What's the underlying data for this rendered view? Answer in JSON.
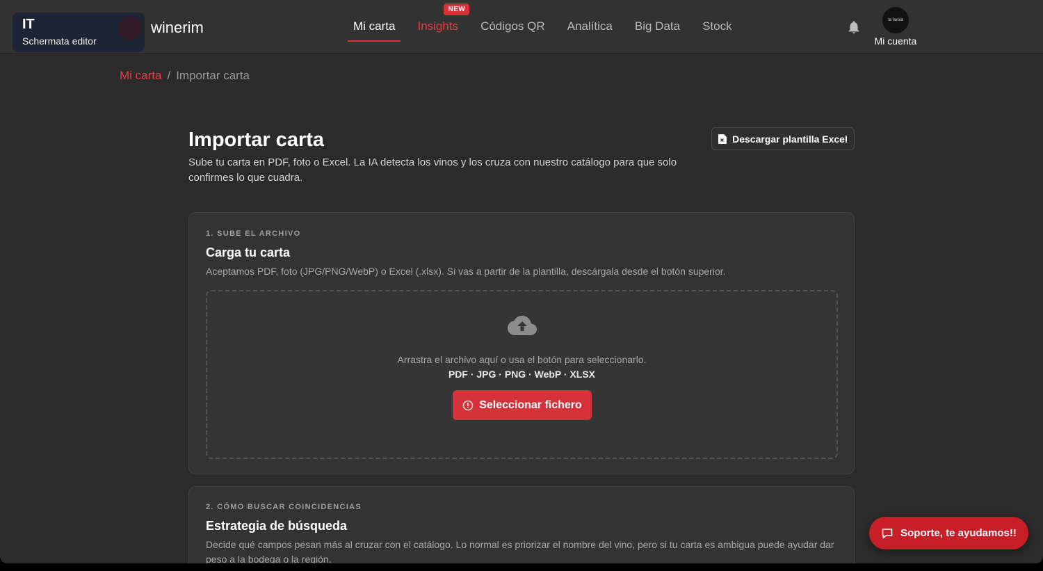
{
  "app": {
    "brand": "winerim",
    "lang_code": "IT",
    "lang_sub": "Schermata editor"
  },
  "nav": {
    "items": [
      {
        "label": "Mi carta",
        "active": true
      },
      {
        "label": "Insights",
        "badge": "NEW"
      },
      {
        "label": "Códigos QR"
      },
      {
        "label": "Analítica"
      },
      {
        "label": "Big Data"
      },
      {
        "label": "Stock"
      }
    ],
    "account_label": "Mi cuenta",
    "avatar_text": "la farola"
  },
  "breadcrumb": {
    "root": "Mi carta",
    "separator": "/",
    "current": "Importar carta"
  },
  "header": {
    "title": "Importar carta",
    "description": "Sube tu carta en PDF, foto o Excel. La IA detecta los vinos y los cruza con nuestro catálogo para que solo confirmes lo que cuadra.",
    "download_label": "Descargar plantilla Excel"
  },
  "step1": {
    "step_label": "1. SUBE EL ARCHIVO",
    "title": "Carga tu carta",
    "description": "Aceptamos PDF, foto (JPG/PNG/WebP) o Excel (.xlsx). Si vas a partir de la plantilla, descárgala desde el botón superior.",
    "drop_text": "Arrastra el archivo aquí o usa el botón para seleccionarlo.",
    "formats": "PDF · JPG · PNG · WebP · XLSX",
    "select_label": "Seleccionar fichero"
  },
  "step2": {
    "step_label": "2. CÓMO BUSCAR COINCIDENCIAS",
    "title": "Estrategia de búsqueda",
    "description": "Decide qué campos pesan más al cruzar con el catálogo. Lo normal es priorizar el nombre del vino, pero si tu carta es ambigua puede ayudar dar peso a la bodega o la región."
  },
  "support": {
    "label": "Soporte, te ayudamos!!"
  },
  "colors": {
    "accent": "#d6323a",
    "background": "#2b2b2b",
    "card": "#333333"
  }
}
